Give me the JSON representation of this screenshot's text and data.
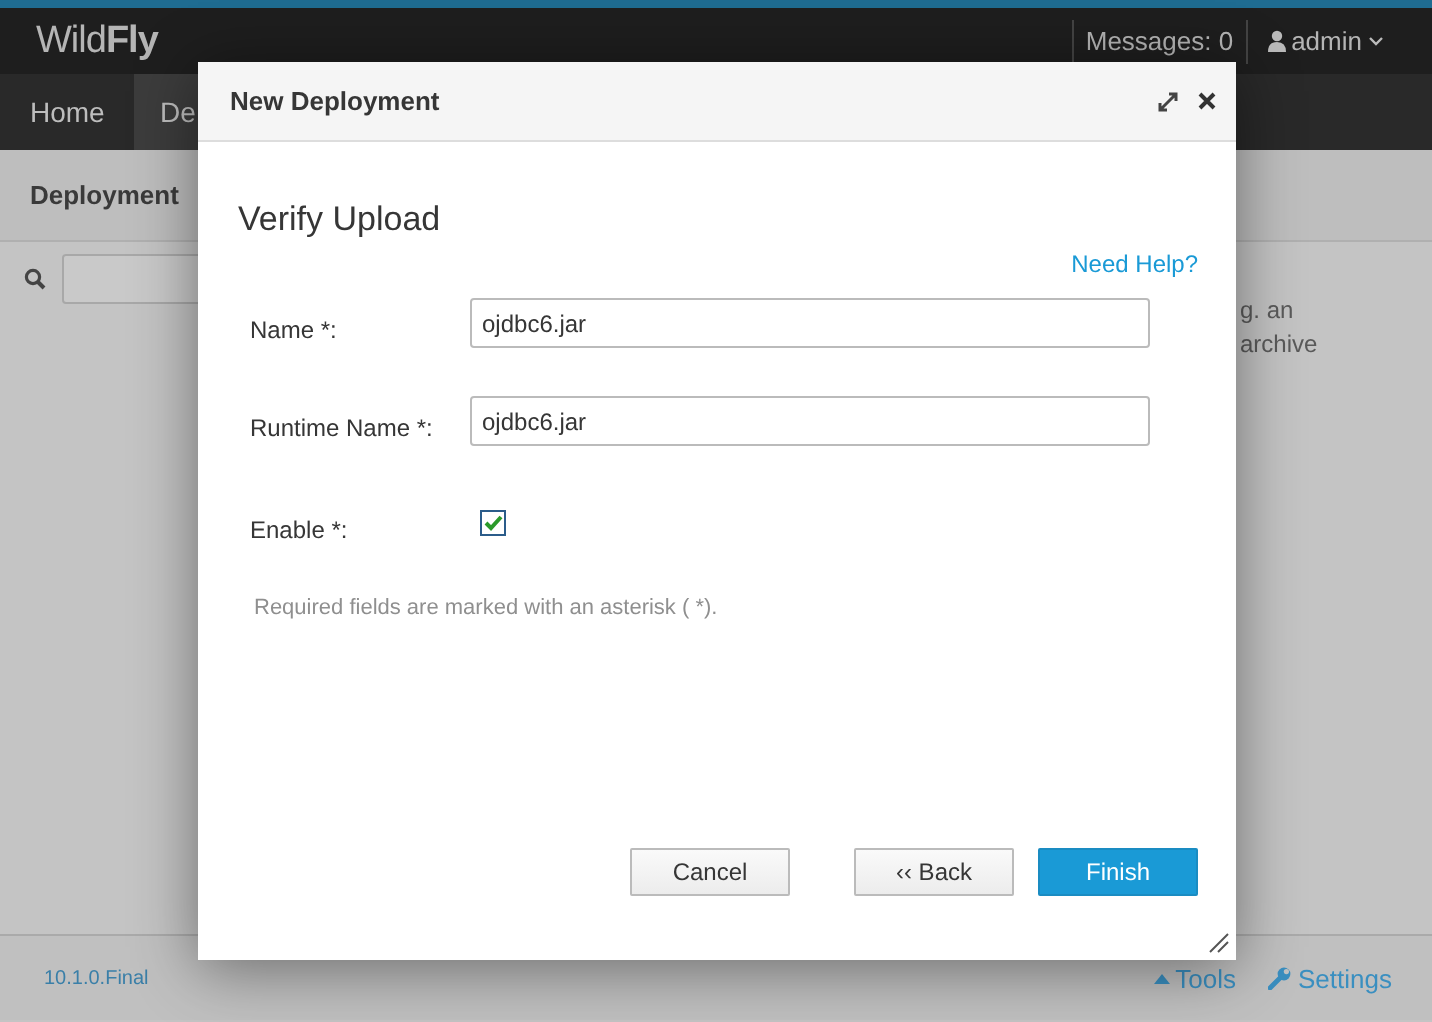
{
  "header": {
    "logo": "Wild**Fly**",
    "messages": "Messages: 0",
    "user": "admin"
  },
  "nav": {
    "tabs": [
      {
        "label": "Home",
        "selected": false
      },
      {
        "label": "De",
        "selected": true
      }
    ]
  },
  "subheader": {
    "title": "Deployment"
  },
  "background_text": [
    "g. an",
    "archive"
  ],
  "footer": {
    "version": "10.1.0.Final",
    "links": [
      {
        "kind": "tools",
        "label": "Tools"
      },
      {
        "kind": "settings",
        "label": "Settings"
      }
    ]
  },
  "dialog": {
    "title": "New Deployment",
    "heading": "Verify Upload",
    "help_link": "Need Help?",
    "fields": [
      {
        "kind": "text",
        "label": "Name *:",
        "value": "ojdbc6.jar"
      },
      {
        "kind": "text",
        "label": "Runtime Name *:",
        "value": "ojdbc6.jar"
      },
      {
        "kind": "checkbox",
        "label": "Enable *:",
        "checked": true
      }
    ],
    "note": "Required fields are marked with an asterisk ( *).",
    "buttons": [
      {
        "label": "Cancel",
        "primary": false
      },
      {
        "label": "‹‹ Back",
        "primary": false
      },
      {
        "label": "Finish",
        "primary": true
      }
    ]
  }
}
